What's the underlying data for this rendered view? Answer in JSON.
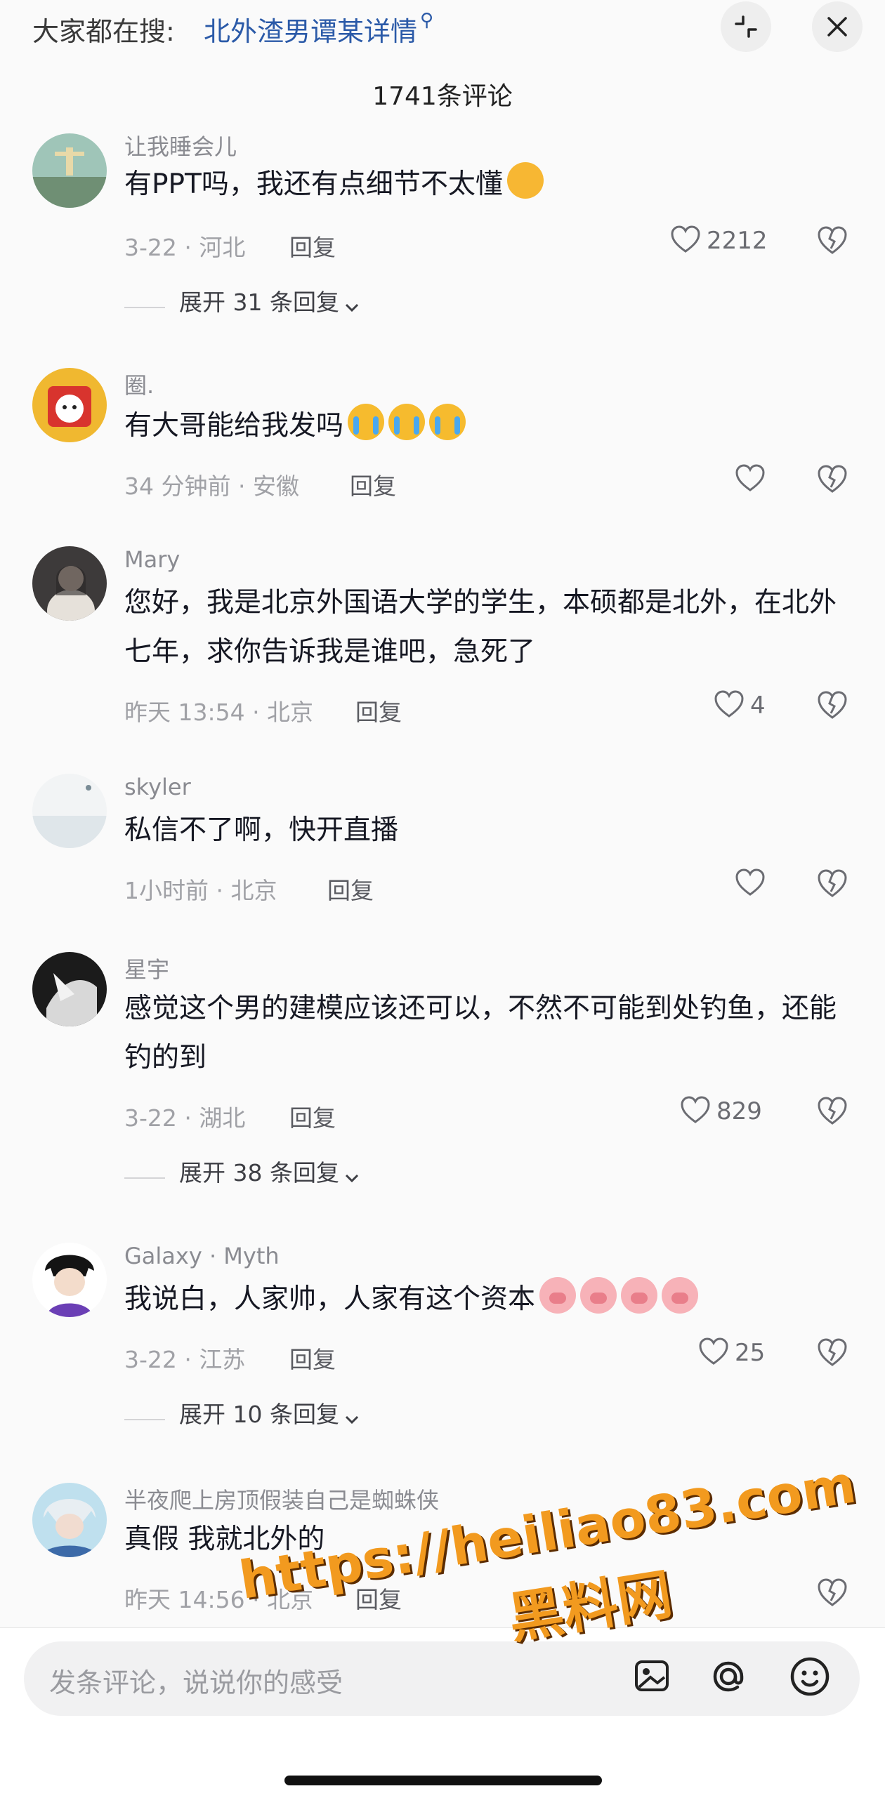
{
  "search": {
    "prefix": "大家都在搜:",
    "term": "北外渣男谭某详情",
    "query_icon": "search-icon"
  },
  "header": {
    "comment_count": "1741条评论"
  },
  "comments": [
    {
      "user": "让我睡会儿",
      "text": "有PPT吗，我还有点细节不太懂",
      "emojis": [
        "smirk"
      ],
      "meta": "3-22 · 河北",
      "reply": "回复",
      "likes": "2212",
      "expand": "展开 31 条回复"
    },
    {
      "user": "圈.",
      "text": "有大哥能给我发吗",
      "emojis": [
        "cry",
        "cry",
        "cry"
      ],
      "meta": "34 分钟前 · 安徽",
      "reply": "回复",
      "likes": ""
    },
    {
      "user": "Mary",
      "text": "您好，我是北京外国语大学的学生，本硕都是北外，在北外 七年，求你告诉我是谁吧，急死了",
      "meta": "昨天 13:54 · 北京",
      "reply": "回复",
      "likes": "4"
    },
    {
      "user": "skyler",
      "text": "私信不了啊，快开直播",
      "meta": "1小时前 · 北京",
      "reply": "回复",
      "likes": ""
    },
    {
      "user": "星宇",
      "text": "感觉这个男的建模应该还可以，不然不可能到处钓鱼，还能钓的到",
      "meta": "3-22 · 湖北",
      "reply": "回复",
      "likes": "829",
      "expand": "展开 38 条回复"
    },
    {
      "user": "Galaxy · Myth",
      "text": "我说白，人家帅，人家有这个资本",
      "emojis": [
        "pig",
        "pig",
        "pig",
        "pig"
      ],
      "meta": "3-22 · 江苏",
      "reply": "回复",
      "likes": "25",
      "expand": "展开 10 条回复"
    },
    {
      "user": "半夜爬上房顶假装自己是蜘蛛侠",
      "text": "真假 我就北外的",
      "meta": "昨天 14:56 · 北京",
      "reply": "回复",
      "likes": ""
    }
  ],
  "input": {
    "placeholder": "发条评论，说说你的感受",
    "icons": [
      "image-icon",
      "at-icon",
      "emoji-icon"
    ]
  },
  "watermark": {
    "url": "https://heiliao83.com",
    "name": "黑料网"
  },
  "colors": {
    "link": "#2b5aa8",
    "watermark": "#f29a1f"
  }
}
